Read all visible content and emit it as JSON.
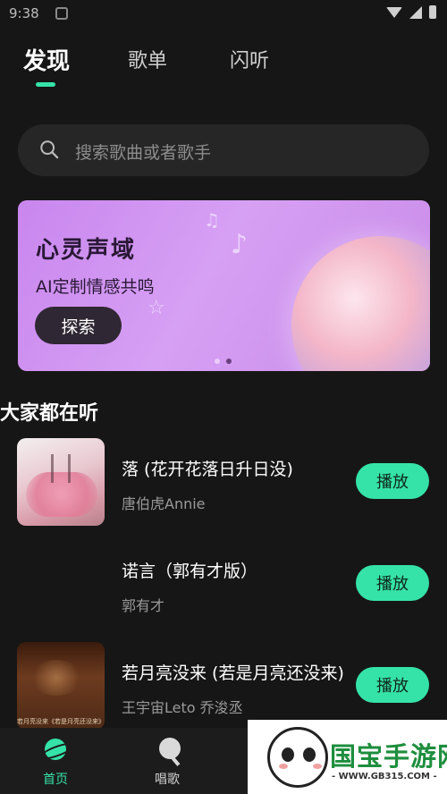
{
  "status_bar": {
    "time": "9:38"
  },
  "tabs": [
    {
      "label": "发现",
      "active": true
    },
    {
      "label": "歌单",
      "active": false
    },
    {
      "label": "闪听",
      "active": false
    }
  ],
  "search": {
    "placeholder": "搜索歌曲或者歌手"
  },
  "banner": {
    "title": "心灵声域",
    "subtitle": "AI定制情感共鸣",
    "button_label": "探索",
    "page_count": 2,
    "active_page": 2
  },
  "section": {
    "title": "大家都在听"
  },
  "songs": [
    {
      "title": "落 (花开花落日升日没)",
      "artist": "唐伯虎Annie",
      "button": "播放"
    },
    {
      "title": "诺言（郭有才版）",
      "artist": "郭有才",
      "button": "播放"
    },
    {
      "title": "若月亮没来 (若是月亮还没来)",
      "artist": "王宇宙Leto 乔浚丞",
      "button": "播放",
      "cover_caption": "若月亮没来《若是月亮还没来》"
    }
  ],
  "bottom_nav": [
    {
      "label": "首页",
      "icon": "planet-icon",
      "active": true
    },
    {
      "label": "唱歌",
      "icon": "microphone-icon",
      "active": false
    }
  ],
  "watermark": {
    "title": "国宝手游网",
    "url": "- WWW.GB315.COM -"
  },
  "colors": {
    "accent": "#35e3a8",
    "background": "#161616",
    "banner": "#d6a0f4"
  }
}
